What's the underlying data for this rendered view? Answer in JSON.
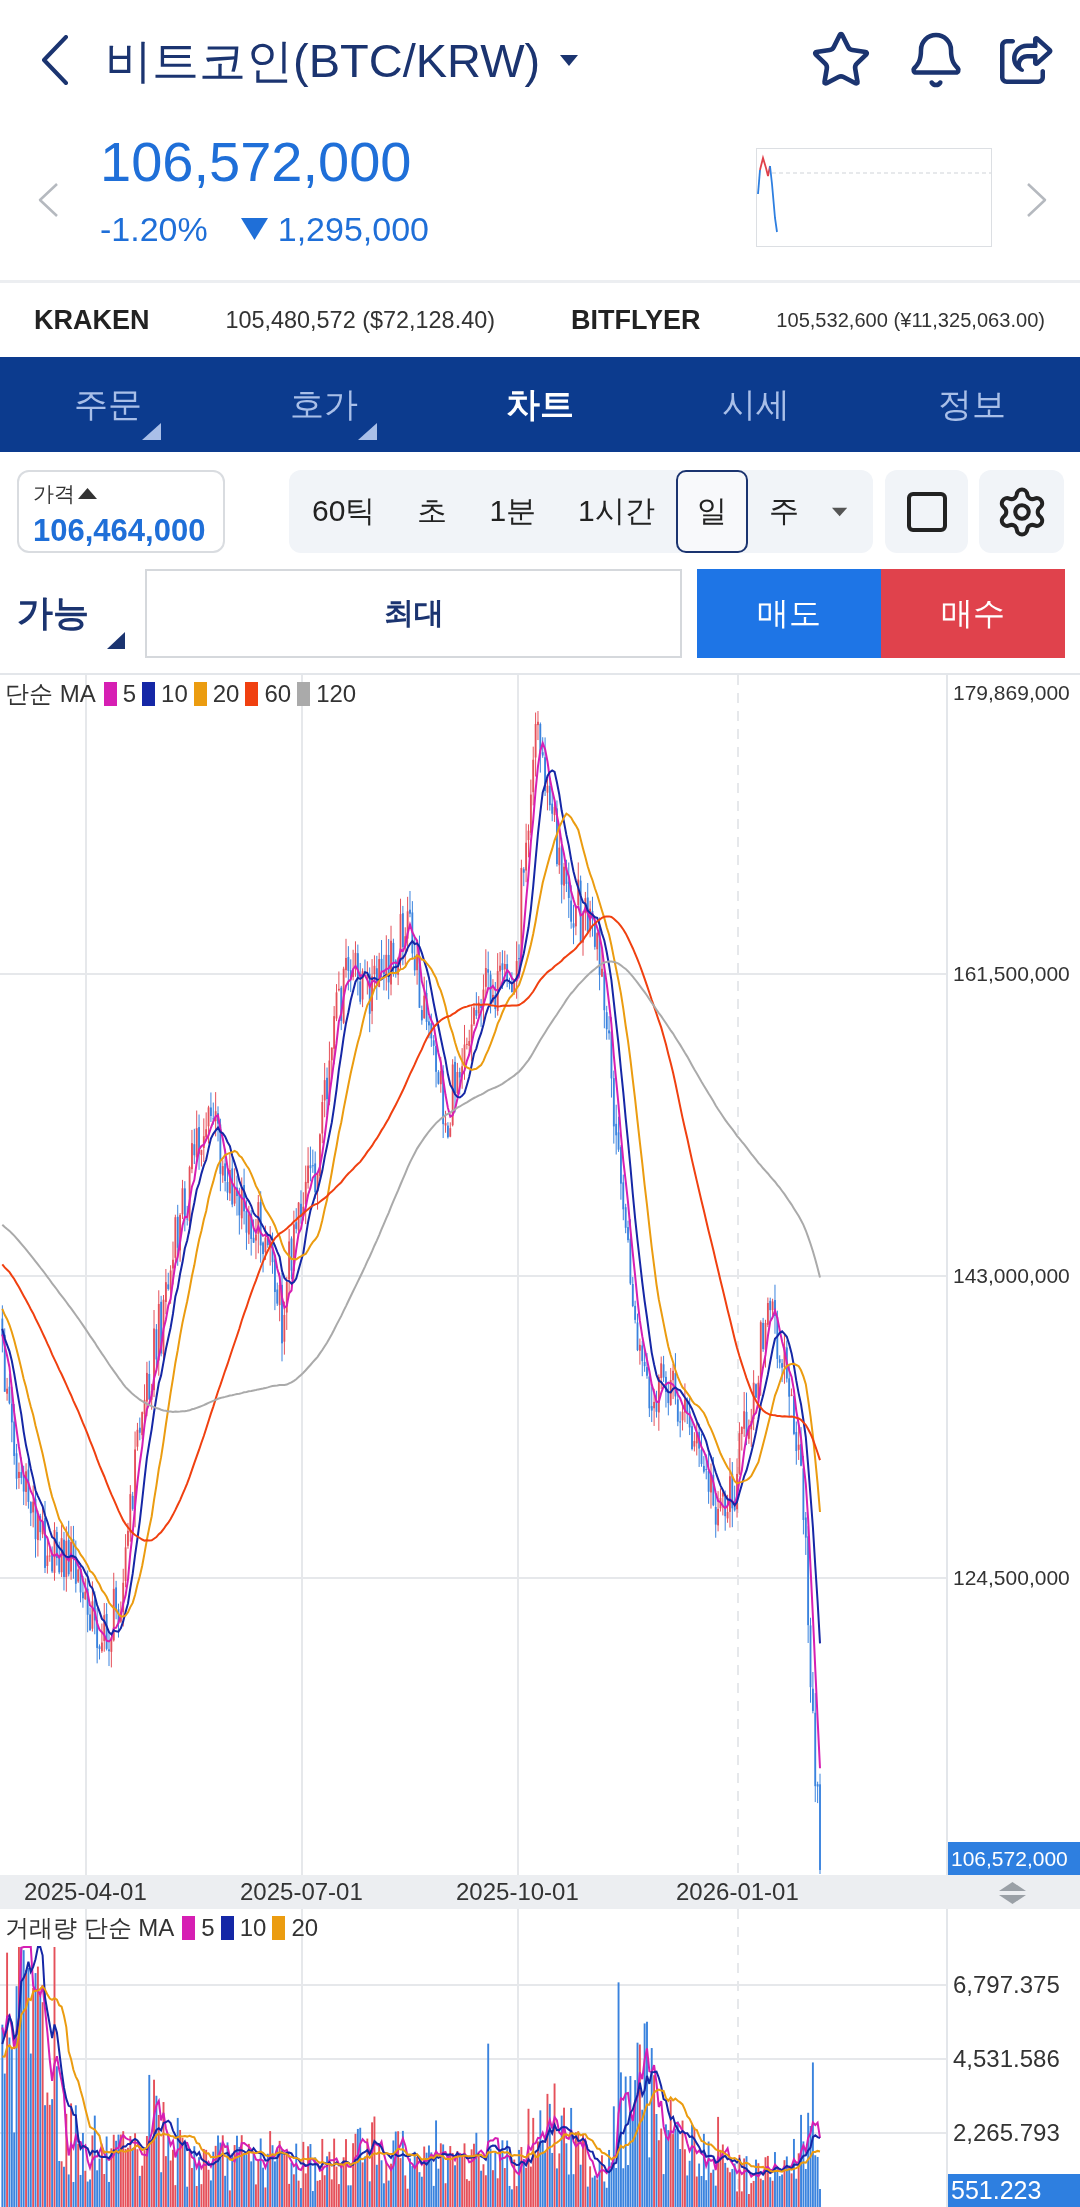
{
  "header": {
    "title": "비트코인(BTC/KRW)"
  },
  "quote": {
    "price": "106,572,000",
    "change_percent": "-1.20%",
    "change_amount": "1,295,000",
    "falling": true
  },
  "exchanges": [
    {
      "name": "KRAKEN",
      "price": "105,480,572 ($72,128.40)"
    },
    {
      "name": "BITFLYER",
      "price": "105,532,600 (¥11,325,063.00)"
    }
  ],
  "tabs": [
    {
      "label": "주문",
      "selected": false,
      "submenu": true
    },
    {
      "label": "호가",
      "selected": false,
      "submenu": true
    },
    {
      "label": "차트",
      "selected": true,
      "submenu": false
    },
    {
      "label": "시세",
      "selected": false,
      "submenu": false
    },
    {
      "label": "정보",
      "selected": false,
      "submenu": false
    }
  ],
  "price_box": {
    "label": "가격",
    "value": "106,464,000"
  },
  "timeframes": [
    {
      "label": "60틱",
      "selected": false
    },
    {
      "label": "초",
      "selected": false
    },
    {
      "label": "1분",
      "selected": false
    },
    {
      "label": "1시간",
      "selected": false
    },
    {
      "label": "일",
      "selected": true
    },
    {
      "label": "주",
      "selected": false
    }
  ],
  "order": {
    "mode": "가능",
    "quantity": "최대",
    "buttons": [
      {
        "label": "매도",
        "kind": "sell"
      },
      {
        "label": "매수",
        "kind": "buy"
      }
    ]
  },
  "price_chart": {
    "legend": {
      "title": "단순 MA",
      "items": [
        {
          "label": "5",
          "color": "#d61fb3"
        },
        {
          "label": "10",
          "color": "#1527a6"
        },
        {
          "label": "20",
          "color": "#eb9c10"
        },
        {
          "label": "60",
          "color": "#f04010"
        },
        {
          "label": "120",
          "color": "#aaaaaa"
        }
      ]
    },
    "y_labels": [
      "179,869,000",
      "161,500,000",
      "143,000,000",
      "124,500,000"
    ],
    "current_tag": "106,572,000"
  },
  "x_axis": {
    "labels": [
      "2025-04-01",
      "2025-07-01",
      "2025-10-01",
      "2026-01-01"
    ]
  },
  "volume_chart": {
    "legend": {
      "title": "거래량 단순 MA",
      "items": [
        {
          "label": "5",
          "color": "#d61fb3"
        },
        {
          "label": "10",
          "color": "#1527a6"
        },
        {
          "label": "20",
          "color": "#eb9c10"
        }
      ]
    },
    "y_labels": [
      "6,797.375",
      "4,531.586",
      "2,265.793"
    ],
    "current_tag": "551.223"
  }
}
